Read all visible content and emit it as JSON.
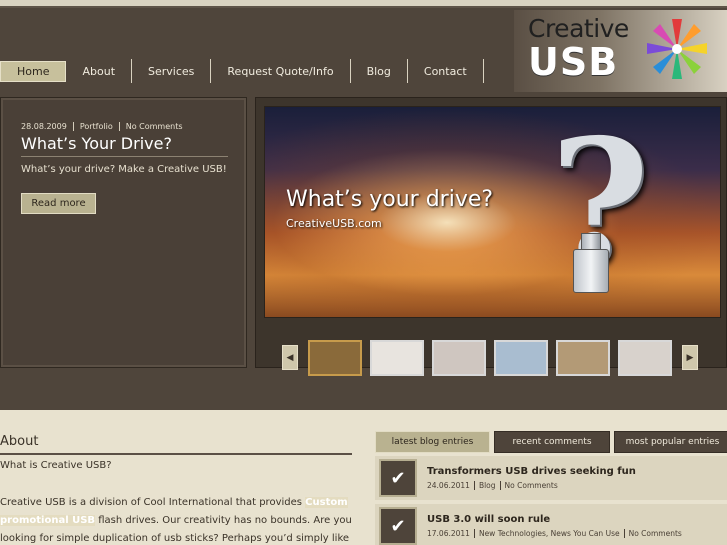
{
  "nav": {
    "items": [
      {
        "label": "Home",
        "active": true
      },
      {
        "label": "About",
        "active": false
      },
      {
        "label": "Services",
        "active": false
      },
      {
        "label": "Request Quote/Info",
        "active": false
      },
      {
        "label": "Blog",
        "active": false
      },
      {
        "label": "Contact",
        "active": false
      }
    ]
  },
  "logo": {
    "line1": "Creative",
    "line2": "USB"
  },
  "featured": {
    "date": "28.08.2009",
    "category": "Portfolio",
    "comments": "No Comments",
    "title": "What’s Your Drive?",
    "excerpt": "What’s your drive?  Make a Creative USB!",
    "read_more": "Read more"
  },
  "slider": {
    "headline": "What’s your drive?",
    "sub": "CreativeUSB.com",
    "thumb_colors": [
      "#8a6a3a",
      "#e8e4df",
      "#cfc6c0",
      "#a9bdd0",
      "#b39a76",
      "#d8d2cc"
    ],
    "prev_icon": "arrow-left-icon",
    "next_icon": "arrow-right-icon"
  },
  "about": {
    "title": "About",
    "question": "What is Creative USB?",
    "body_pre": "Creative USB is a division of Cool International that provides ",
    "body_hl": "Custom promotional USB",
    "body_post": " flash drives. Our creativity has no bounds.  Are you looking for simple duplication of usb sticks?  Perhaps you’d simply like your company"
  },
  "blog": {
    "tabs": [
      {
        "label": "latest blog entries",
        "active": true
      },
      {
        "label": "recent comments",
        "active": false
      },
      {
        "label": "most popular entries",
        "active": false
      }
    ],
    "entries": [
      {
        "title": "Transformers USB drives seeking fun",
        "date": "24.06.2011",
        "category": "Blog",
        "comments": "No Comments"
      },
      {
        "title": "USB 3.0 will soon rule",
        "date": "17.06.2011",
        "category": "New Technologies, News You Can Use",
        "comments": "No Comments"
      }
    ],
    "check_icon": "check-icon"
  }
}
